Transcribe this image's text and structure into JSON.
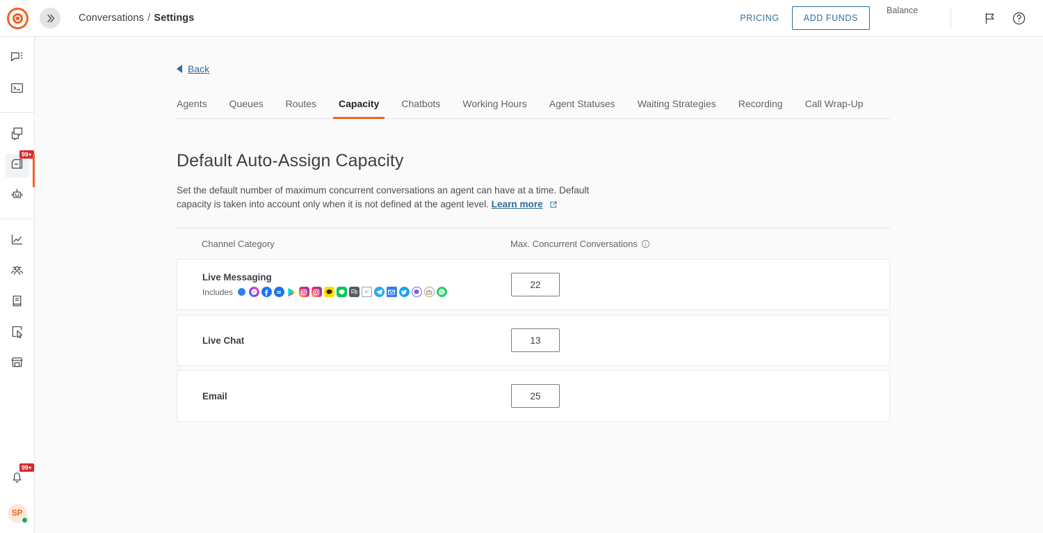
{
  "header": {
    "logo_name": "brand-target-logo",
    "expand_icon": "double-chevron-right-icon",
    "breadcrumb_root": "Conversations",
    "breadcrumb_sep": "/",
    "breadcrumb_current": "Settings",
    "pricing_label": "PRICING",
    "add_funds_label": "ADD FUNDS",
    "balance_label": "Balance",
    "balance_value": "",
    "announce_icon": "megaphone-icon",
    "help_icon": "help-circle-icon"
  },
  "sidebar": {
    "groups": [
      {
        "items": [
          {
            "name": "conversations-icon",
            "label": "Conversations",
            "badge": "",
            "active": false
          },
          {
            "name": "terminal-icon",
            "label": "Console",
            "badge": "",
            "active": false
          }
        ]
      },
      {
        "items": [
          {
            "name": "copy-conversations-icon",
            "label": "Copy",
            "badge": "",
            "active": false
          },
          {
            "name": "inbox-icon",
            "label": "Inbox",
            "badge": "99+",
            "active": true
          },
          {
            "name": "chatbot-robot-icon",
            "label": "Chatbots",
            "badge": "",
            "active": false
          }
        ]
      },
      {
        "items": [
          {
            "name": "analytics-chart-icon",
            "label": "Analytics",
            "badge": "",
            "active": false
          },
          {
            "name": "contacts-users-icon",
            "label": "Contacts",
            "badge": "",
            "active": false
          },
          {
            "name": "knowledge-book-icon",
            "label": "Knowledge Base",
            "badge": "",
            "active": false
          },
          {
            "name": "campaign-cursor-icon",
            "label": "Campaigns",
            "badge": "",
            "active": false
          },
          {
            "name": "marketplace-store-icon",
            "label": "Marketplace",
            "badge": "",
            "active": false
          }
        ]
      }
    ],
    "bottom": {
      "notifications_icon": "bell-icon",
      "notifications_badge": "99+",
      "avatar_initials": "SP",
      "status": "online"
    }
  },
  "back": {
    "label": "Back",
    "icon": "back-arrow-icon"
  },
  "tabs": [
    {
      "label": "Agents",
      "active": false
    },
    {
      "label": "Queues",
      "active": false
    },
    {
      "label": "Routes",
      "active": false
    },
    {
      "label": "Capacity",
      "active": true
    },
    {
      "label": "Chatbots",
      "active": false
    },
    {
      "label": "Working Hours",
      "active": false
    },
    {
      "label": "Agent Statuses",
      "active": false
    },
    {
      "label": "Waiting Strategies",
      "active": false
    },
    {
      "label": "Recording",
      "active": false
    },
    {
      "label": "Call Wrap-Up",
      "active": false
    }
  ],
  "section": {
    "title": "Default Auto-Assign Capacity",
    "description": "Set the default number of maximum concurrent conversations an agent can have at a time. Default capacity is taken into account only when it is not defined at the agent level.",
    "learn_more": "Learn more",
    "external_icon": "external-link-icon"
  },
  "table": {
    "columns": {
      "category": "Channel Category",
      "max": "Max. Concurrent Conversations",
      "max_info_icon": "info-icon"
    },
    "rows": [
      {
        "name": "Live Messaging",
        "includes_label": "Includes",
        "value": "22",
        "channels": [
          {
            "name": "generic-message-icon",
            "color": "#2f80ed"
          },
          {
            "name": "facebook-messenger-icon",
            "color": "#a334fa"
          },
          {
            "name": "facebook-icon",
            "color": "#1877f2"
          },
          {
            "name": "messenger-chat-icon",
            "color": "#1a73e8"
          },
          {
            "name": "google-play-icon",
            "color": "#3ddc84"
          },
          {
            "name": "instagram-icon",
            "color": "#e1306c"
          },
          {
            "name": "instagram-direct-icon",
            "color": "#e1306c"
          },
          {
            "name": "kakaotalk-icon",
            "color": "#fae100"
          },
          {
            "name": "line-icon",
            "color": "#06c755"
          },
          {
            "name": "chat-dark-icon",
            "color": "#4a4f54"
          },
          {
            "name": "form-note-icon",
            "color": "#9aa0a6"
          },
          {
            "name": "telegram-icon",
            "color": "#2aabee"
          },
          {
            "name": "email-icon",
            "color": "#2f80ed"
          },
          {
            "name": "twitter-icon",
            "color": "#1da1f2"
          },
          {
            "name": "viber-icon",
            "color": "#7360f2"
          },
          {
            "name": "bot-icon",
            "color": "#8e8e93"
          },
          {
            "name": "whatsapp-icon",
            "color": "#25d366"
          }
        ]
      },
      {
        "name": "Live Chat",
        "includes_label": "",
        "value": "13",
        "channels": []
      },
      {
        "name": "Email",
        "includes_label": "",
        "value": "25",
        "channels": []
      }
    ]
  },
  "colors": {
    "accent": "#f26122",
    "link": "#2c6e9b",
    "badge": "#d9252a",
    "online": "#18a957"
  }
}
